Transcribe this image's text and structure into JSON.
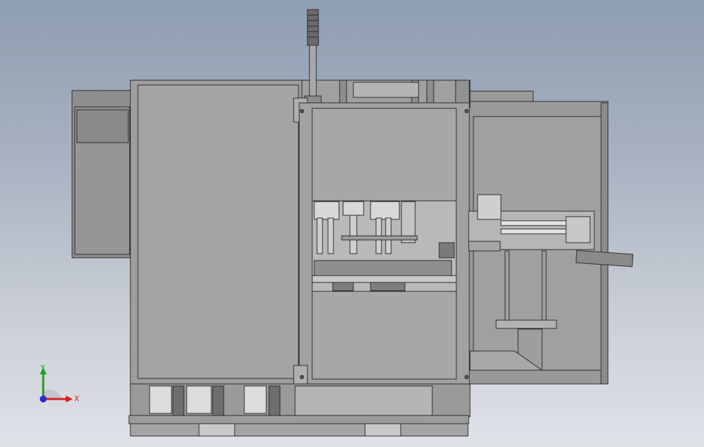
{
  "viewport": {
    "background_top": "#8f9db2",
    "background_bottom": "#dfe2e7"
  },
  "model": {
    "body_color": "#9a9a9a",
    "panel_color": "#a3a3a3",
    "edge_color": "#2b2b2b",
    "light_part_color": "#dcdcdc",
    "dark_part_color": "#6e6e6e"
  },
  "triad": {
    "x_label": "X",
    "y_label": "Y",
    "x_color": "#d92020",
    "y_color": "#1fa01f",
    "z_color": "#2a2ad0"
  }
}
